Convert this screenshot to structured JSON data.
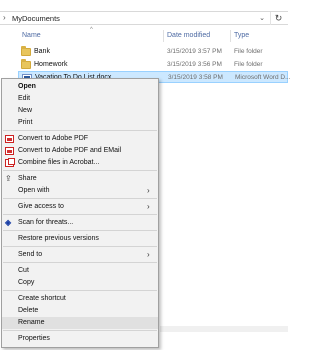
{
  "address": {
    "path": "MyDocuments"
  },
  "columns": {
    "name": "Name",
    "date": "Date modified",
    "type": "Type"
  },
  "files": [
    {
      "name": "Bank",
      "date": "3/15/2019 3:57 PM",
      "type": "File folder",
      "icon": "folder-icon"
    },
    {
      "name": "Homework",
      "date": "3/15/2019 3:56 PM",
      "type": "File folder",
      "icon": "folder-icon"
    },
    {
      "name": "Vacation To Do List.docx",
      "date": "3/15/2019 3:58 PM",
      "type": "Microsoft Word D...",
      "icon": "word-doc-icon"
    }
  ],
  "menu": {
    "open": "Open",
    "edit": "Edit",
    "new": "New",
    "print": "Print",
    "convert_pdf": "Convert to Adobe PDF",
    "convert_pdf_email": "Convert to Adobe PDF and EMail",
    "combine": "Combine files in Acrobat...",
    "share": "Share",
    "open_with": "Open with",
    "give_access": "Give access to",
    "scan": "Scan for threats...",
    "restore": "Restore previous versions",
    "send_to": "Send to",
    "cut": "Cut",
    "copy": "Copy",
    "create_shortcut": "Create shortcut",
    "delete": "Delete",
    "rename": "Rename",
    "properties": "Properties"
  },
  "colors": {
    "selection": "#cce8ff",
    "header_text": "#4d6aa3",
    "menu_bg": "#f2f2f2"
  }
}
